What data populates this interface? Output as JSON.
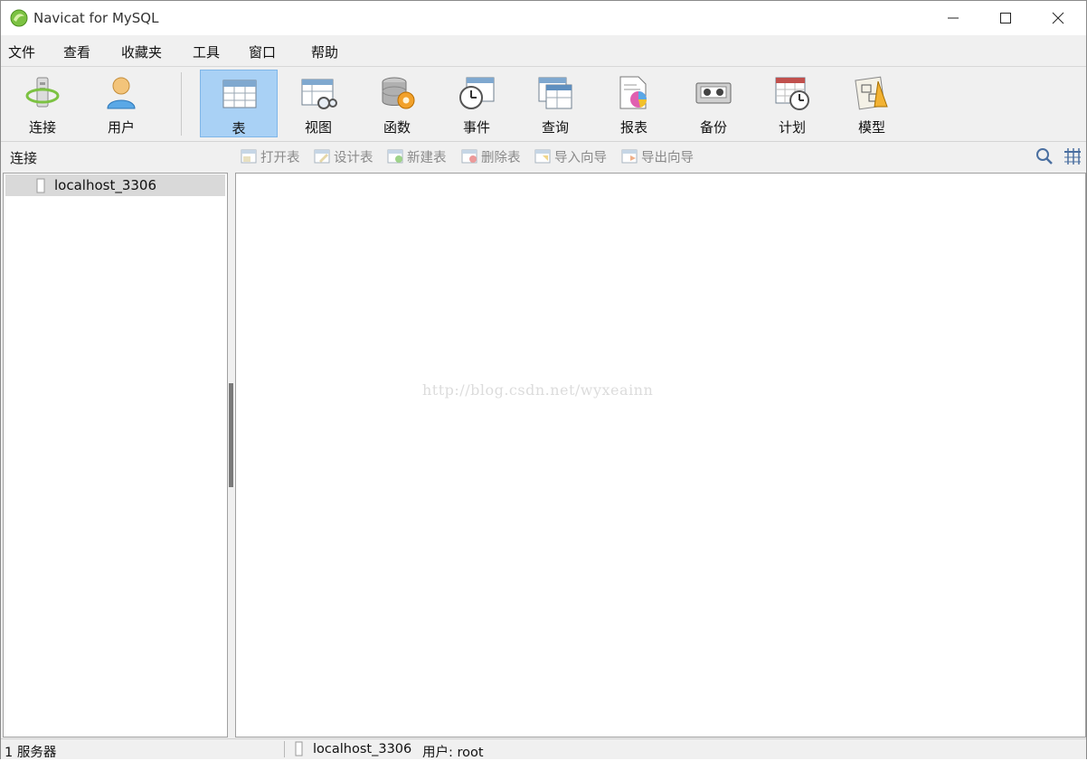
{
  "window": {
    "title": "Navicat for MySQL"
  },
  "menu": {
    "items": [
      {
        "label": "文件"
      },
      {
        "label": "查看"
      },
      {
        "label": "收藏夹"
      },
      {
        "label": "工具"
      },
      {
        "label": "窗口"
      },
      {
        "label": "帮助"
      }
    ]
  },
  "toolbar": {
    "items": [
      {
        "label": "连接",
        "icon": "connection-icon"
      },
      {
        "label": "用户",
        "icon": "user-icon"
      },
      {
        "label": "表",
        "icon": "table-icon",
        "active": true
      },
      {
        "label": "视图",
        "icon": "view-icon"
      },
      {
        "label": "函数",
        "icon": "function-icon"
      },
      {
        "label": "事件",
        "icon": "event-icon"
      },
      {
        "label": "查询",
        "icon": "query-icon"
      },
      {
        "label": "报表",
        "icon": "report-icon"
      },
      {
        "label": "备份",
        "icon": "backup-icon"
      },
      {
        "label": "计划",
        "icon": "schedule-icon"
      },
      {
        "label": "模型",
        "icon": "model-icon"
      }
    ],
    "active_color": "#a9d1f5"
  },
  "sidebar": {
    "header": "连接",
    "connections": [
      {
        "name": "localhost_3306"
      }
    ]
  },
  "actions": {
    "items": [
      {
        "label": "打开表",
        "icon": "open-table-icon"
      },
      {
        "label": "设计表",
        "icon": "design-table-icon"
      },
      {
        "label": "新建表",
        "icon": "new-table-icon"
      },
      {
        "label": "删除表",
        "icon": "delete-table-icon"
      },
      {
        "label": "导入向导",
        "icon": "import-wizard-icon"
      },
      {
        "label": "导出向导",
        "icon": "export-wizard-icon"
      }
    ],
    "search_icon": "search-icon",
    "view_icon": "grid-view-icon"
  },
  "main": {
    "watermark": "http://blog.csdn.net/wyxeainn"
  },
  "status": {
    "servers": "1 服务器",
    "connection": "localhost_3306",
    "user": "用户: root"
  }
}
